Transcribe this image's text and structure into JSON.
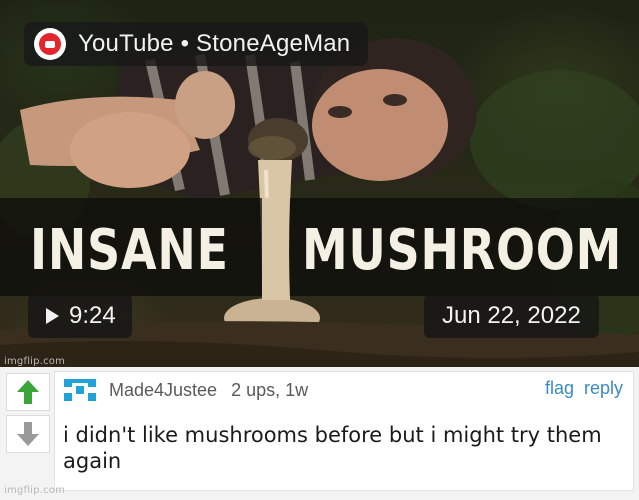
{
  "thumbnail": {
    "channel_label": "YouTube • StoneAgeMan",
    "headline_left": "INSANE",
    "headline_right": "MUSHROOM",
    "duration": "9:24",
    "date": "Jun 22, 2022",
    "watermark": "imgflip.com"
  },
  "comment": {
    "username": "Made4Justee",
    "stats": "2 ups, 1w",
    "flag_label": "flag",
    "reply_label": "reply",
    "text": "i didn't like mushrooms before but i might try them again",
    "upvote_icon": "arrow-up-icon",
    "downvote_icon": "arrow-down-icon",
    "colors": {
      "upvote": "#3aa63a",
      "downvote": "#9a9a9a",
      "link": "#3a8ac4",
      "avatar": "#1ea2d8"
    }
  },
  "footer": {
    "watermark": "imgflip.com"
  }
}
